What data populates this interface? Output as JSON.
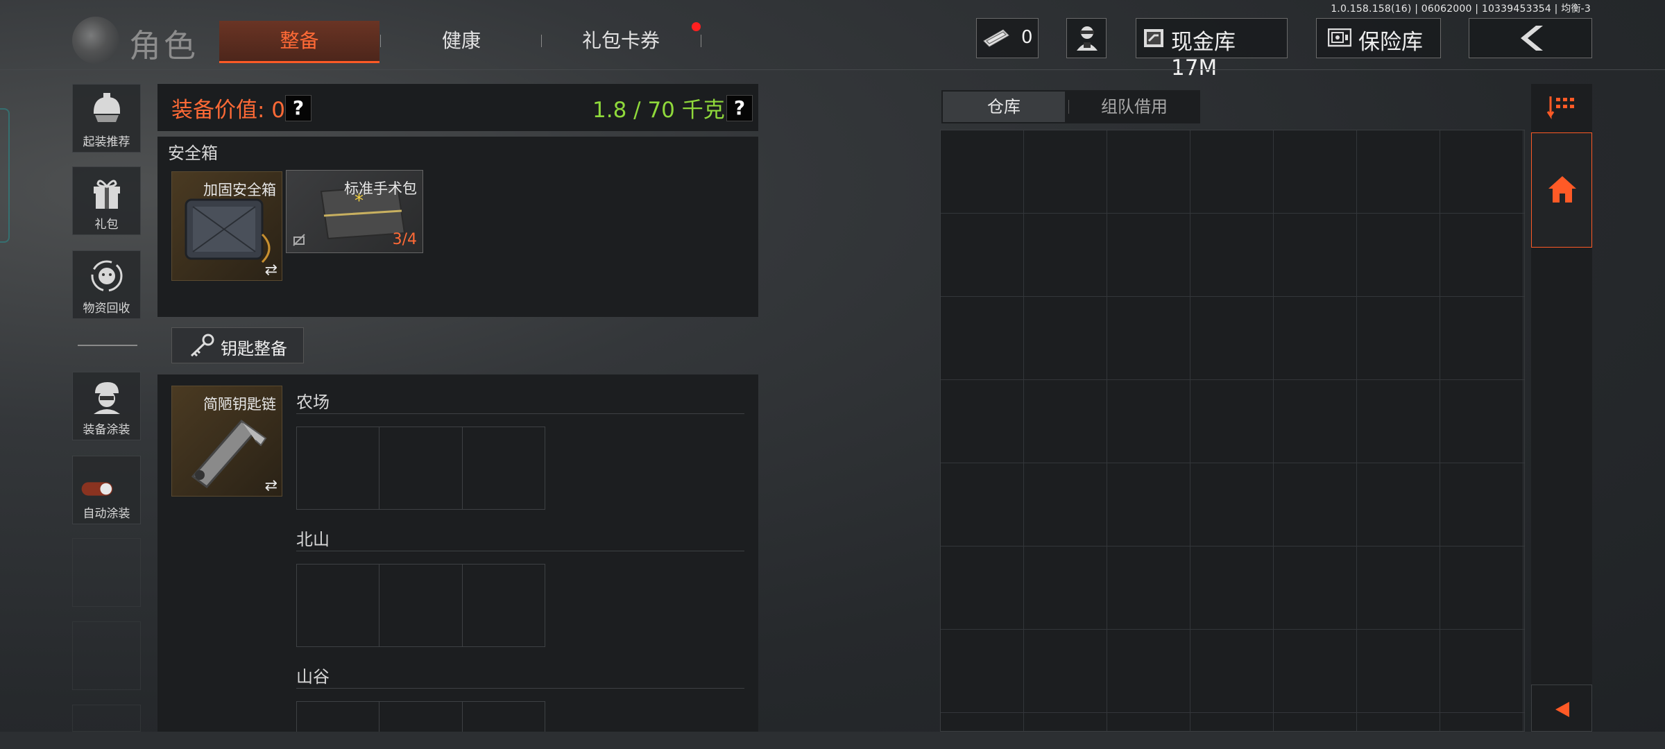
{
  "version": "1.0.158.158(16) | 06062000 | 10339453354 | 均衡-3",
  "header": {
    "title": "角色",
    "tabs": [
      {
        "label": "整备",
        "active": true
      },
      {
        "label": "健康",
        "active": false
      },
      {
        "label": "礼包卡券",
        "active": false,
        "notification": true
      }
    ],
    "cash_value": "0",
    "vault_label": "现金库 17M",
    "safe_label": "保险库"
  },
  "sidebar": {
    "items": [
      {
        "label": "起装推荐",
        "icon": "helmet-icon"
      },
      {
        "label": "礼包",
        "icon": "gift-icon"
      },
      {
        "label": "物资回收",
        "icon": "recycle-icon"
      },
      {
        "label": "装备涂装",
        "icon": "soldier-icon"
      },
      {
        "label": "自动涂装",
        "icon": "toggle-icon"
      }
    ]
  },
  "equipment": {
    "value_label": "装备价值: 0",
    "weight_label": "1.8 / 70 千克",
    "help": "?",
    "safebox_title": "安全箱",
    "safebox_item": "加固安全箱",
    "surgical_item": "标准手术包",
    "surgical_count": "3/4",
    "keys_button": "钥匙整备",
    "keychain_item": "简陋钥匙链",
    "maps": [
      "农场",
      "北山",
      "山谷"
    ]
  },
  "storage": {
    "tabs": [
      {
        "label": "仓库",
        "active": true
      },
      {
        "label": "组队借用",
        "active": false
      }
    ]
  },
  "colors": {
    "accent": "#ff5a26",
    "weight": "#8fd93b",
    "notification": "#ff2020"
  }
}
